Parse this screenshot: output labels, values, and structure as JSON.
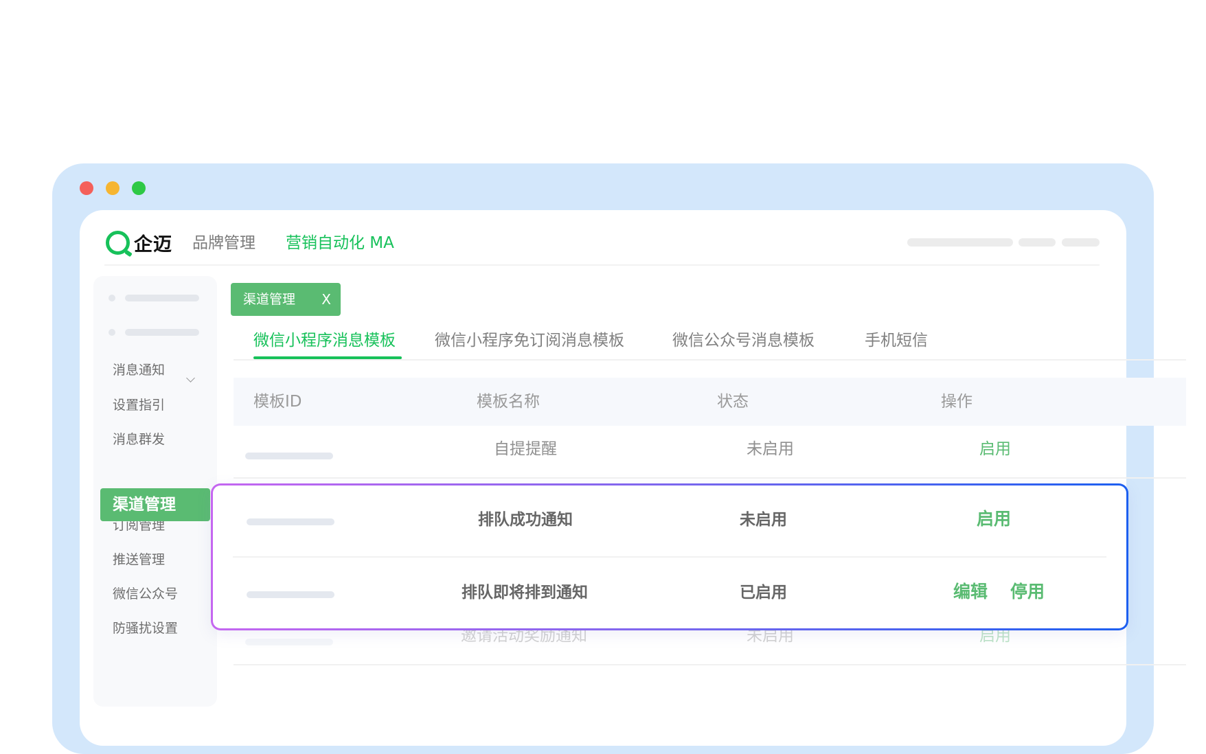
{
  "window": {
    "controls": [
      {
        "name": "close",
        "color": "#f4605a"
      },
      {
        "name": "minimize",
        "color": "#f6b531"
      },
      {
        "name": "maximize",
        "color": "#2ec945"
      }
    ]
  },
  "header": {
    "logo_text": "企迈",
    "nav": [
      {
        "label": "品牌管理",
        "active": false
      },
      {
        "label": "营销自动化 MA",
        "active": true
      }
    ]
  },
  "sidebar": {
    "items": [
      {
        "label": "消息通知",
        "expandable": true
      },
      {
        "label": "设置指引"
      },
      {
        "label": "消息群发"
      },
      {
        "label": "渠道管理",
        "active": true
      },
      {
        "label": "订阅管理"
      },
      {
        "label": "推送管理"
      },
      {
        "label": "微信公众号"
      },
      {
        "label": "防骚扰设置"
      }
    ]
  },
  "page_tag": {
    "label": "渠道管理",
    "close_label": "X"
  },
  "tabs": [
    {
      "label": "微信小程序消息模板",
      "active": true
    },
    {
      "label": "微信小程序免订阅消息模板",
      "active": false
    },
    {
      "label": "微信公众号消息模板",
      "active": false
    },
    {
      "label": "手机短信",
      "active": false
    }
  ],
  "table": {
    "columns": [
      "模板ID",
      "模板名称",
      "状态",
      "操作"
    ],
    "rows": [
      {
        "name": "自提提醒",
        "status": "未启用",
        "actions": [
          "启用"
        ]
      },
      {
        "name": "排队成功通知",
        "status": "未启用",
        "actions": [
          "启用"
        ]
      },
      {
        "name": "排队即将排到通知",
        "status": "已启用",
        "actions": [
          "编辑",
          "停用"
        ]
      },
      {
        "name": "邀请活动奖励通知",
        "status": "未启用",
        "actions": [
          "启用"
        ]
      }
    ]
  },
  "colors": {
    "brand_green": "#17c15a",
    "button_green": "#5abb72",
    "frame_blue": "#d3e7fb"
  }
}
